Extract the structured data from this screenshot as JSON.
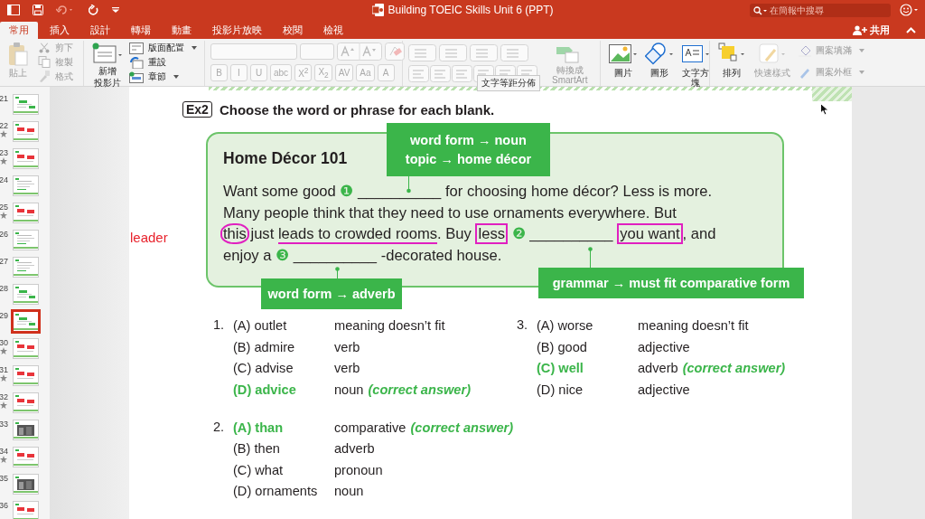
{
  "window": {
    "title": "Building TOEIC Skills Unit 6 (PPT)",
    "search": {
      "placeholder": "在簡報中搜尋"
    }
  },
  "tabs": [
    {
      "label": "常用",
      "selected": true
    },
    {
      "label": "插入",
      "selected": false
    },
    {
      "label": "設計",
      "selected": false
    },
    {
      "label": "轉場",
      "selected": false
    },
    {
      "label": "動畫",
      "selected": false
    },
    {
      "label": "投影片放映",
      "selected": false
    },
    {
      "label": "校閱",
      "selected": false
    },
    {
      "label": "檢視",
      "selected": false
    }
  ],
  "share": {
    "label": "共用"
  },
  "ribbon": {
    "clipboard": {
      "paste": {
        "label": "貼上",
        "disabled": true
      },
      "items": [
        {
          "label": "剪下",
          "disabled": true
        },
        {
          "label": "複製",
          "disabled": true
        },
        {
          "label": "格式",
          "disabled": true
        }
      ]
    },
    "slides": {
      "new_slide": {
        "label_lines": [
          "新增",
          "投影片"
        ],
        "disabled": false
      },
      "items": [
        {
          "label": "版面配置",
          "disabled": false
        },
        {
          "label": "重設",
          "disabled": false
        },
        {
          "label": "章節",
          "disabled": false
        }
      ]
    },
    "font_buttons": [
      {
        "label": "B"
      },
      {
        "label": "I"
      },
      {
        "label": "U"
      },
      {
        "label": "abc"
      },
      {
        "label": "X$^{2}$"
      },
      {
        "label": "X$_{2}$"
      },
      {
        "label": "AV"
      },
      {
        "label": "Aa"
      },
      {
        "label": "A"
      }
    ],
    "smartart": {
      "label": "轉換成\nSmartArt",
      "disabled": true
    },
    "insert": [
      {
        "label": "圖片",
        "disabled": false
      },
      {
        "label": "圖形",
        "disabled": false
      },
      {
        "label": "文字方塊",
        "disabled": false
      }
    ],
    "arrange": [
      {
        "label": "排列",
        "disabled": false
      },
      {
        "label": "快速樣式",
        "disabled": true
      }
    ],
    "shape_items": [
      {
        "label": "圖案填滿",
        "disabled": true
      },
      {
        "label": "圖案外框",
        "disabled": true
      }
    ]
  },
  "tooltip": "文字等距分佈",
  "thumbnails": [
    {
      "number": "21",
      "kind": "green",
      "star": false,
      "selected": false
    },
    {
      "number": "22",
      "kind": "red",
      "star": true,
      "selected": false
    },
    {
      "number": "23",
      "kind": "red",
      "star": true,
      "selected": false
    },
    {
      "number": "24",
      "kind": "text",
      "star": false,
      "selected": false
    },
    {
      "number": "25",
      "kind": "red",
      "star": true,
      "selected": false
    },
    {
      "number": "26",
      "kind": "text",
      "star": false,
      "selected": false
    },
    {
      "number": "27",
      "kind": "text",
      "star": false,
      "selected": false
    },
    {
      "number": "28",
      "kind": "green",
      "star": false,
      "selected": false
    },
    {
      "number": "29",
      "kind": "green",
      "star": false,
      "selected": true
    },
    {
      "number": "30",
      "kind": "red",
      "star": true,
      "selected": false
    },
    {
      "number": "31",
      "kind": "red",
      "star": true,
      "selected": false
    },
    {
      "number": "32",
      "kind": "red",
      "star": true,
      "selected": false
    },
    {
      "number": "33",
      "kind": "photo",
      "star": false,
      "selected": false
    },
    {
      "number": "34",
      "kind": "red",
      "star": true,
      "selected": false
    },
    {
      "number": "35",
      "kind": "photo",
      "star": false,
      "selected": false
    },
    {
      "number": "36",
      "kind": "red",
      "star": false,
      "selected": false
    }
  ],
  "slide": {
    "exercise_tag": "Ex2",
    "instruction": "Choose the word or phrase for each blank.",
    "note": "leader",
    "passage": {
      "title": "Home Décor 101",
      "lines": [
        [
          {
            "text": "Want some good ",
            "kind": "plain"
          },
          {
            "text": "❶",
            "kind": "number"
          },
          {
            "text": " __________ for choosing home décor? Less is more.",
            "kind": "plain"
          }
        ],
        [
          {
            "text": "Many people think that they need to use ornaments everywhere. But",
            "kind": "plain"
          }
        ],
        [
          {
            "text": "this",
            "kind": "circle"
          },
          {
            "text": " just ",
            "kind": "plain"
          },
          {
            "text": "leads to crowded rooms",
            "kind": "underline"
          },
          {
            "text": ". Buy ",
            "kind": "plain"
          },
          {
            "text": "less",
            "kind": "box"
          },
          {
            "text": " ❷",
            "kind": "number"
          },
          {
            "text": " __________ ",
            "kind": "plain"
          },
          {
            "text": "you want",
            "kind": "box"
          },
          {
            "text": ", and",
            "kind": "plain"
          }
        ],
        [
          {
            "text": "enjoy a ",
            "kind": "plain"
          },
          {
            "text": "❸",
            "kind": "number"
          },
          {
            "text": " __________ -decorated house.",
            "kind": "plain"
          }
        ]
      ]
    },
    "callouts": [
      {
        "lines": [
          "word form → noun",
          "topic → home décor"
        ]
      },
      {
        "lines": [
          "word form → adverb"
        ]
      },
      {
        "lines": [
          "grammar → must fit comparative form"
        ]
      }
    ],
    "questions": [
      {
        "number": "1.",
        "options": [
          {
            "label": "(A) outlet",
            "note": "meaning doesn’t fit",
            "correct": false
          },
          {
            "label": "(B) admire",
            "note": "verb",
            "correct": false
          },
          {
            "label": "(C) advise",
            "note": "verb",
            "correct": false
          },
          {
            "label": "(D) advice",
            "note": "noun",
            "tag": "(correct answer)",
            "correct": true
          }
        ]
      },
      {
        "number": "3.",
        "options": [
          {
            "label": "(A) worse",
            "note": "meaning doesn’t fit",
            "correct": false
          },
          {
            "label": "(B) good",
            "note": "adjective",
            "correct": false
          },
          {
            "label": "(C) well",
            "note": "adverb",
            "tag": "(correct answer)",
            "correct": true
          },
          {
            "label": "(D) nice",
            "note": "adjective",
            "correct": false
          }
        ]
      },
      {
        "number": "2.",
        "options": [
          {
            "label": "(A) than",
            "note": "comparative",
            "tag": "(correct answer)",
            "correct": true
          },
          {
            "label": "(B) then",
            "note": "adverb",
            "correct": false
          },
          {
            "label": "(C) what",
            "note": "pronoun",
            "correct": false
          },
          {
            "label": "(D) ornaments",
            "note": "noun",
            "correct": false
          }
        ]
      }
    ]
  }
}
